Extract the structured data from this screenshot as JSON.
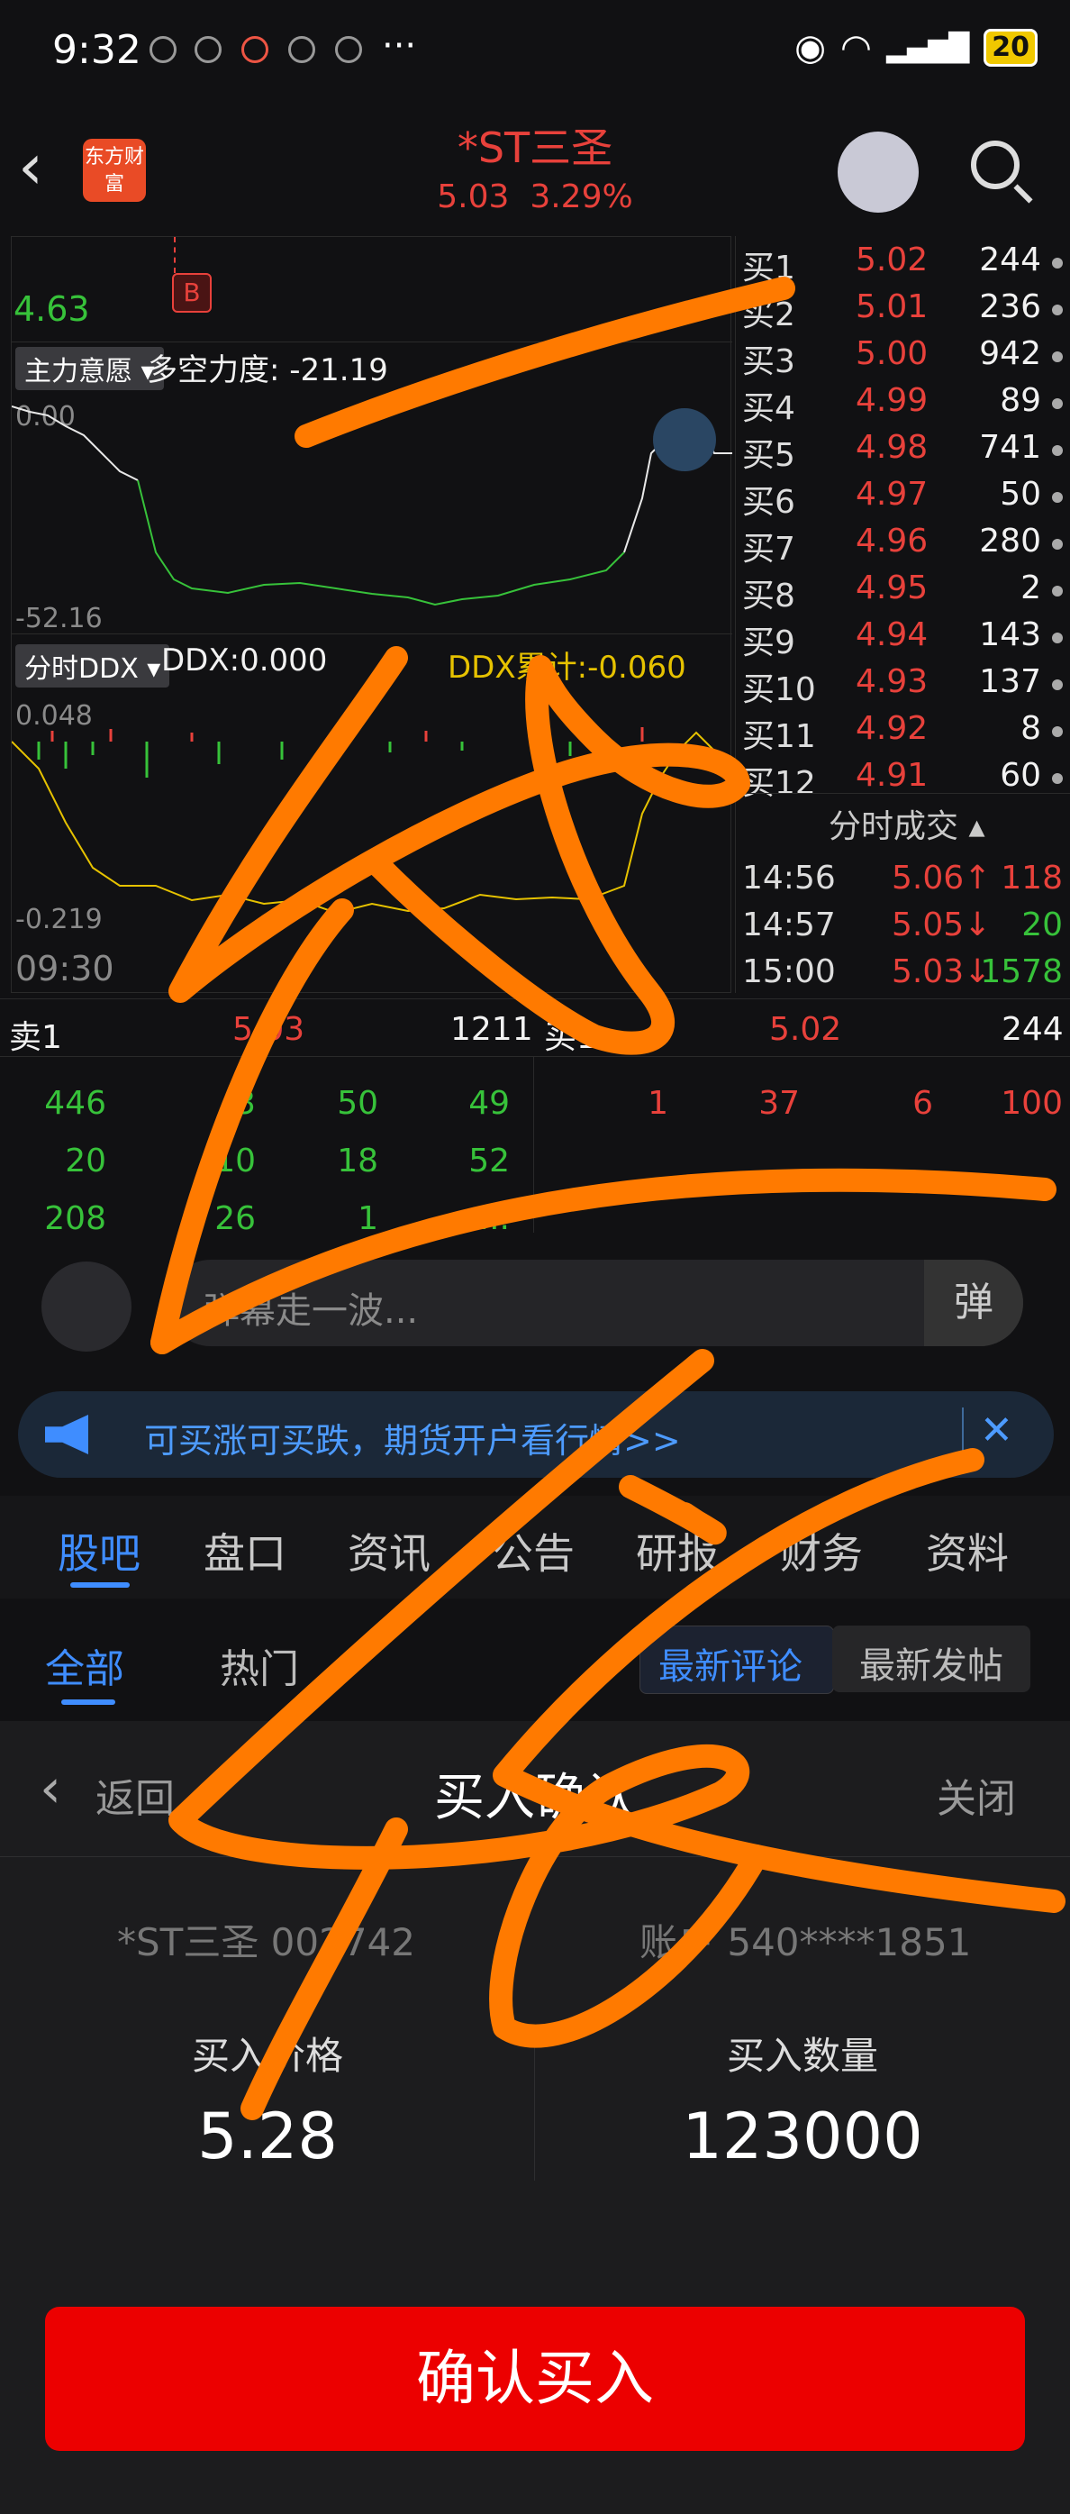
{
  "status_bar": {
    "time": "9:32",
    "more": "···",
    "battery": "20"
  },
  "header": {
    "logo_text": "东方财富",
    "stock_name": "*ST三圣",
    "price": "5.03",
    "change_pct": "3.29%"
  },
  "chart": {
    "price_top": "4.63",
    "buy_marker": "B",
    "indicator1": {
      "tag": "主力意愿",
      "label": "多空力度: -21.19",
      "top_value": "0.00",
      "bottom_value": "-52.16"
    },
    "indicator2": {
      "tag": "分时DDX",
      "label": "DDX:0.000",
      "label2": "DDX累计:-0.060",
      "top_value": "0.048",
      "bottom_value": "-0.219"
    },
    "start_time": "09:30"
  },
  "order_book": [
    {
      "label": "买1",
      "price": "5.02",
      "volume": "244"
    },
    {
      "label": "买2",
      "price": "5.01",
      "volume": "236"
    },
    {
      "label": "买3",
      "price": "5.00",
      "volume": "942"
    },
    {
      "label": "买4",
      "price": "4.99",
      "volume": "89"
    },
    {
      "label": "买5",
      "price": "4.98",
      "volume": "741"
    },
    {
      "label": "买6",
      "price": "4.97",
      "volume": "50"
    },
    {
      "label": "买7",
      "price": "4.96",
      "volume": "280"
    },
    {
      "label": "买8",
      "price": "4.95",
      "volume": "2"
    },
    {
      "label": "买9",
      "price": "4.94",
      "volume": "143"
    },
    {
      "label": "买10",
      "price": "4.93",
      "volume": "137"
    },
    {
      "label": "买11",
      "price": "4.92",
      "volume": "8"
    },
    {
      "label": "买12",
      "price": "4.91",
      "volume": "60"
    }
  ],
  "trades": {
    "title": "分时成交",
    "rows": [
      {
        "time": "14:56",
        "price": "5.06↑",
        "volume": "118"
      },
      {
        "time": "14:57",
        "price": "5.05↓",
        "volume": "20"
      },
      {
        "time": "15:00",
        "price": "5.03↓",
        "volume": "1578"
      }
    ]
  },
  "level2": {
    "sell_label": "卖1",
    "sell_price": "5.03",
    "sell_volume": "1211",
    "buy_label": "买1",
    "buy_price": "5.02",
    "buy_volume": "244",
    "sell_queue": [
      [
        "446",
        "3",
        "50",
        "49"
      ],
      [
        "20",
        "10",
        "18",
        "52"
      ],
      [
        "208",
        "26",
        "1",
        "..."
      ]
    ],
    "buy_queue": [
      [
        "1",
        "37",
        "6",
        "100"
      ]
    ]
  },
  "danmaku": {
    "placeholder": "弹幕走一波...",
    "button": "弹"
  },
  "ad": {
    "text": "可买涨可买跌，期货开户看行情>>",
    "close": "✕"
  },
  "tabs": [
    "股吧",
    "盘口",
    "资讯",
    "公告",
    "研报",
    "财务",
    "资料"
  ],
  "subtabs": {
    "items": [
      "全部",
      "热门"
    ],
    "sort_latest_comment": "最新评论",
    "sort_latest_post": "最新发帖"
  },
  "sheet": {
    "back": "返回",
    "title": "买入确认",
    "close": "关闭",
    "stock_code": "*ST三圣 002742",
    "account": "账户 540****1851",
    "price_label": "买入价格",
    "price_value": "5.28",
    "qty_label": "买入数量",
    "qty_value": "123000",
    "confirm": "确认买入"
  }
}
